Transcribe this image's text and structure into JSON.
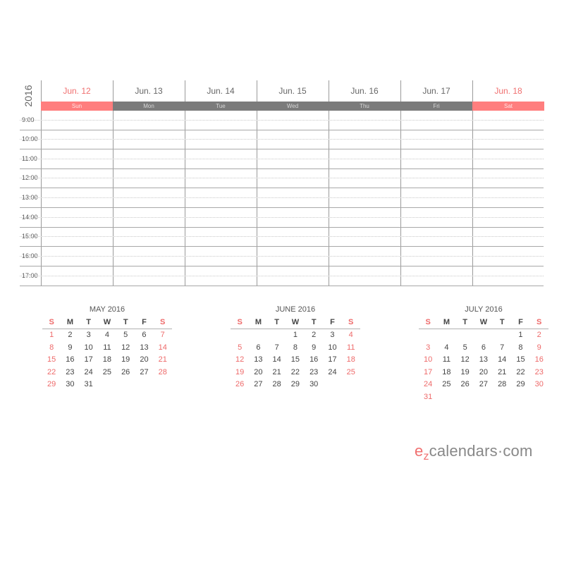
{
  "year": "2016",
  "days": [
    {
      "date": "Jun. 12",
      "weekday": "Sun",
      "weekend": true
    },
    {
      "date": "Jun. 13",
      "weekday": "Mon",
      "weekend": false
    },
    {
      "date": "Jun. 14",
      "weekday": "Tue",
      "weekend": false
    },
    {
      "date": "Jun. 15",
      "weekday": "Wed",
      "weekend": false
    },
    {
      "date": "Jun. 16",
      "weekday": "Thu",
      "weekend": false
    },
    {
      "date": "Jun. 17",
      "weekday": "Fri",
      "weekend": false
    },
    {
      "date": "Jun. 18",
      "weekday": "Sat",
      "weekend": true
    }
  ],
  "times": [
    "9:00",
    "10:00",
    "11:00",
    "12:00",
    "13:00",
    "14:00",
    "15:00",
    "16:00",
    "17:00"
  ],
  "mini_calendars": [
    {
      "title": "MAY 2016",
      "headers": [
        "S",
        "M",
        "T",
        "W",
        "T",
        "F",
        "S"
      ],
      "weeks": [
        [
          "1",
          "2",
          "3",
          "4",
          "5",
          "6",
          "7"
        ],
        [
          "8",
          "9",
          "10",
          "11",
          "12",
          "13",
          "14"
        ],
        [
          "15",
          "16",
          "17",
          "18",
          "19",
          "20",
          "21"
        ],
        [
          "22",
          "23",
          "24",
          "25",
          "26",
          "27",
          "28"
        ],
        [
          "29",
          "30",
          "31",
          "",
          "",
          "",
          ""
        ]
      ]
    },
    {
      "title": "JUNE 2016",
      "headers": [
        "S",
        "M",
        "T",
        "W",
        "T",
        "F",
        "S"
      ],
      "weeks": [
        [
          "",
          "",
          "",
          "1",
          "2",
          "3",
          "4"
        ],
        [
          "5",
          "6",
          "7",
          "8",
          "9",
          "10",
          "11"
        ],
        [
          "12",
          "13",
          "14",
          "15",
          "16",
          "17",
          "18"
        ],
        [
          "19",
          "20",
          "21",
          "22",
          "23",
          "24",
          "25"
        ],
        [
          "26",
          "27",
          "28",
          "29",
          "30",
          "",
          ""
        ]
      ]
    },
    {
      "title": "JULY 2016",
      "headers": [
        "S",
        "M",
        "T",
        "W",
        "T",
        "F",
        "S"
      ],
      "weeks": [
        [
          "",
          "",
          "",
          "",
          "",
          "1",
          "2"
        ],
        [
          "3",
          "4",
          "5",
          "6",
          "7",
          "8",
          "9"
        ],
        [
          "10",
          "11",
          "12",
          "13",
          "14",
          "15",
          "16"
        ],
        [
          "17",
          "18",
          "19",
          "20",
          "21",
          "22",
          "23"
        ],
        [
          "24",
          "25",
          "26",
          "27",
          "28",
          "29",
          "30"
        ],
        [
          "31",
          "",
          "",
          "",
          "",
          "",
          ""
        ]
      ]
    }
  ],
  "brand": {
    "e": "e",
    "z": "z",
    "rest": "calendars·com"
  },
  "colors": {
    "weekend": "#ff7e7e",
    "weekday_bar": "#7b7b7b",
    "weekend_text": "#f07070"
  }
}
